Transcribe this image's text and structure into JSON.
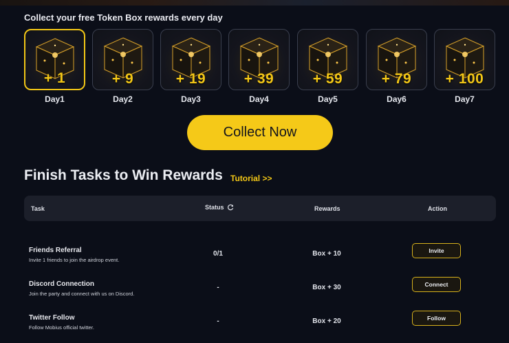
{
  "daily": {
    "title": "Collect your free Token Box rewards every day",
    "days": [
      {
        "label": "Day1",
        "reward": "+ 1",
        "active": true
      },
      {
        "label": "Day2",
        "reward": "+ 9",
        "active": false
      },
      {
        "label": "Day3",
        "reward": "+ 19",
        "active": false
      },
      {
        "label": "Day4",
        "reward": "+ 39",
        "active": false
      },
      {
        "label": "Day5",
        "reward": "+ 59",
        "active": false
      },
      {
        "label": "Day6",
        "reward": "+ 79",
        "active": false
      },
      {
        "label": "Day7",
        "reward": "+ 100",
        "active": false
      }
    ],
    "collect_label": "Collect Now"
  },
  "tasks": {
    "title": "Finish Tasks to Win Rewards",
    "tutorial_label": "Tutorial >>",
    "headers": {
      "task": "Task",
      "status": "Status",
      "rewards": "Rewards",
      "action": "Action"
    },
    "rows": [
      {
        "title": "Friends Referral",
        "desc": "Invite 1 friends to join the airdrop event.",
        "status": "0/1",
        "reward": "Box + 10",
        "action": "Invite"
      },
      {
        "title": "Discord Connection",
        "desc": "Join the party and connect with us on Discord.",
        "status": "-",
        "reward": "Box + 30",
        "action": "Connect"
      },
      {
        "title": "Twitter Follow",
        "desc": "Follow Mobius official twitter.",
        "status": "-",
        "reward": "Box + 20",
        "action": "Follow"
      }
    ]
  },
  "colors": {
    "accent": "#f3c716",
    "background": "#0b0e18",
    "panel": "#1c1f2a"
  },
  "icons": {
    "status_refresh": "refresh-icon",
    "box": "token-box-icon"
  }
}
